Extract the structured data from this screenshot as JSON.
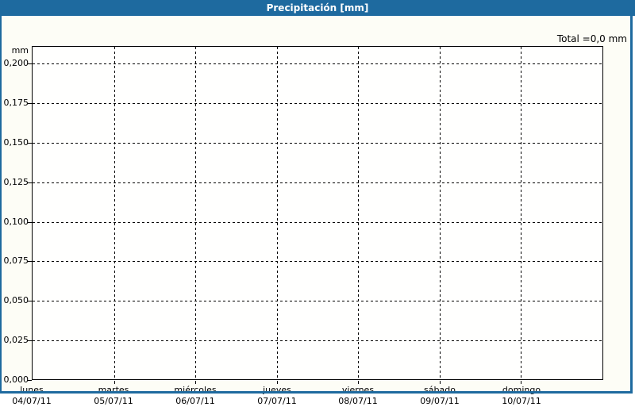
{
  "window": {
    "title": "Precipitación [mm]"
  },
  "header": {
    "total_label": "Total =0,0 mm"
  },
  "chart_data": {
    "type": "bar",
    "title": "Precipitación [mm]",
    "ylabel": "mm",
    "unit_label": "mm",
    "total_label": "Total =0,0 mm",
    "total_value_mm": 0.0,
    "ylim": [
      0,
      0.2
    ],
    "grid": "dashed",
    "legend": "none",
    "y_ticks": [
      {
        "value": 0.2,
        "label": "0,200"
      },
      {
        "value": 0.175,
        "label": "0,175"
      },
      {
        "value": 0.15,
        "label": "0,150"
      },
      {
        "value": 0.125,
        "label": "0,125"
      },
      {
        "value": 0.1,
        "label": "0,100"
      },
      {
        "value": 0.075,
        "label": "0,075"
      },
      {
        "value": 0.05,
        "label": "0,050"
      },
      {
        "value": 0.025,
        "label": "0,025"
      },
      {
        "value": 0.0,
        "label": "0,000"
      }
    ],
    "categories": [
      {
        "day": "lunes",
        "date": "04/07/11"
      },
      {
        "day": "martes",
        "date": "05/07/11"
      },
      {
        "day": "miércoles",
        "date": "06/07/11"
      },
      {
        "day": "jueves",
        "date": "07/07/11"
      },
      {
        "day": "viernes",
        "date": "08/07/11"
      },
      {
        "day": "sábado",
        "date": "09/07/11"
      },
      {
        "day": "domingo",
        "date": "10/07/11"
      }
    ],
    "series": [
      {
        "name": "Precipitación",
        "values": [
          0,
          0,
          0,
          0,
          0,
          0,
          0
        ]
      }
    ]
  },
  "colors": {
    "titlebar_bg": "#1e6a9f",
    "frame_border": "#1e6a9f",
    "grid_line": "#000000",
    "text": "#000000",
    "title_text": "#ffffff",
    "background": "#fdfdf6",
    "plot_background": "#fffffe"
  }
}
